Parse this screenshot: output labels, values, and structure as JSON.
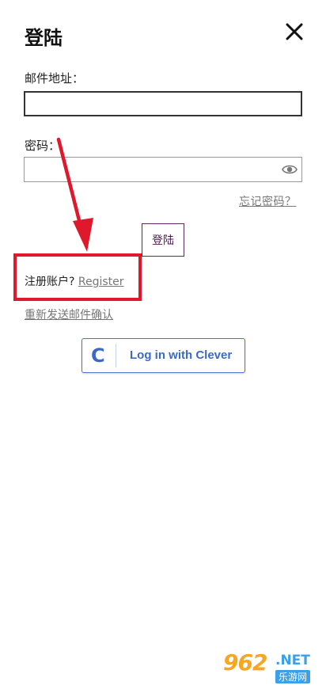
{
  "header": {
    "title": "登陆"
  },
  "form": {
    "email_label": "邮件地址：",
    "email_value": "",
    "password_label": "密码：",
    "password_value": "",
    "forgot_password": "忘记密码？",
    "login_button": "登陆"
  },
  "register": {
    "prompt": "注册账户? ",
    "link": "Register"
  },
  "resend_confirmation": "重新发送邮件确认",
  "clever": {
    "logo": "C",
    "label": "Log in with Clever"
  },
  "watermark": {
    "brand": "962",
    "net": ".NET",
    "cn": "乐游网"
  },
  "colors": {
    "highlight": "#e0182c",
    "clever_blue": "#3b6ac6",
    "login_button_text": "#4a1a4a"
  }
}
